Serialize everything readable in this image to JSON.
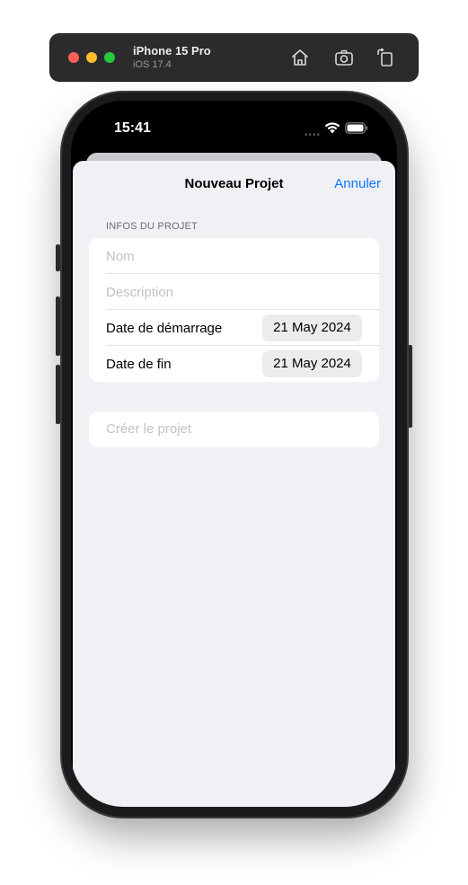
{
  "simulator": {
    "device_name": "iPhone 15 Pro",
    "os_version": "iOS 17.4",
    "icons": [
      "home-icon",
      "screenshot-icon",
      "rotate-icon"
    ]
  },
  "status_bar": {
    "time": "15:41",
    "icons": [
      "wifi-icon",
      "battery-icon"
    ]
  },
  "nav": {
    "title": "Nouveau Projet",
    "cancel_label": "Annuler"
  },
  "form": {
    "section_header": "INFOS DU PROJET",
    "name_placeholder": "Nom",
    "name_value": "",
    "description_placeholder": "Description",
    "description_value": "",
    "start_date_label": "Date de démarrage",
    "start_date_value": "21 May 2024",
    "end_date_label": "Date de fin",
    "end_date_value": "21 May 2024",
    "create_label": "Créer le projet"
  },
  "colors": {
    "accent": "#0a7aff",
    "sheet_background": "#f0f0f5",
    "placeholder": "#c2c2c6"
  }
}
